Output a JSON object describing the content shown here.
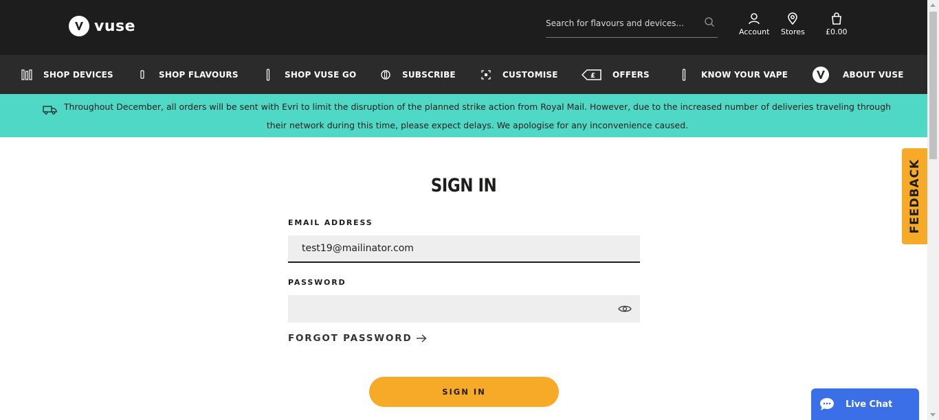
{
  "brand": {
    "name": "vuse"
  },
  "search": {
    "placeholder": "Search for flavours and devices..."
  },
  "header_links": {
    "account": "Account",
    "stores": "Stores",
    "basket": "£0.00"
  },
  "nav": {
    "shop_devices": "SHOP DEVICES",
    "shop_flavours": "SHOP FLAVOURS",
    "shop_vuse_go": "SHOP VUSE GO",
    "subscribe": "SUBSCRIBE",
    "customise": "CUSTOMISE",
    "offers": "OFFERS",
    "know_your_vape": "KNOW YOUR VAPE",
    "about_vuse": "ABOUT VUSE"
  },
  "banner": {
    "text": "Throughout December, all orders will be sent with Evri to limit the disruption of the planned strike action from Royal Mail. However, due to the increased number of deliveries traveling through their network during this time, please expect delays. We apologise for any inconvenience caused."
  },
  "form": {
    "title": "SIGN IN",
    "email_label": "EMAIL ADDRESS",
    "email_value": "test19@mailinator.com",
    "password_label": "PASSWORD",
    "password_value": "",
    "forgot_label": "FORGOT PASSWORD",
    "submit_label": "SIGN IN"
  },
  "feedback": {
    "label": "FEEDBACK"
  },
  "live_chat": {
    "label": "Live Chat"
  },
  "colors": {
    "header_bg": "#1d1d1d",
    "nav_bg": "#2b2b2b",
    "banner_bg": "#4fd8c6",
    "accent": "#f7a928",
    "chat_blue": "#3a6fe8"
  },
  "icons": {
    "logo": "vuse-v-logo-icon",
    "search": "search-icon",
    "account": "user-icon",
    "stores": "map-pin-icon",
    "basket": "shopping-bag-icon",
    "password_toggle": "eye-icon",
    "forgot_arrow": "arrow-right-icon",
    "banner": "truck-icon",
    "chat": "chat-bubble-icon"
  }
}
